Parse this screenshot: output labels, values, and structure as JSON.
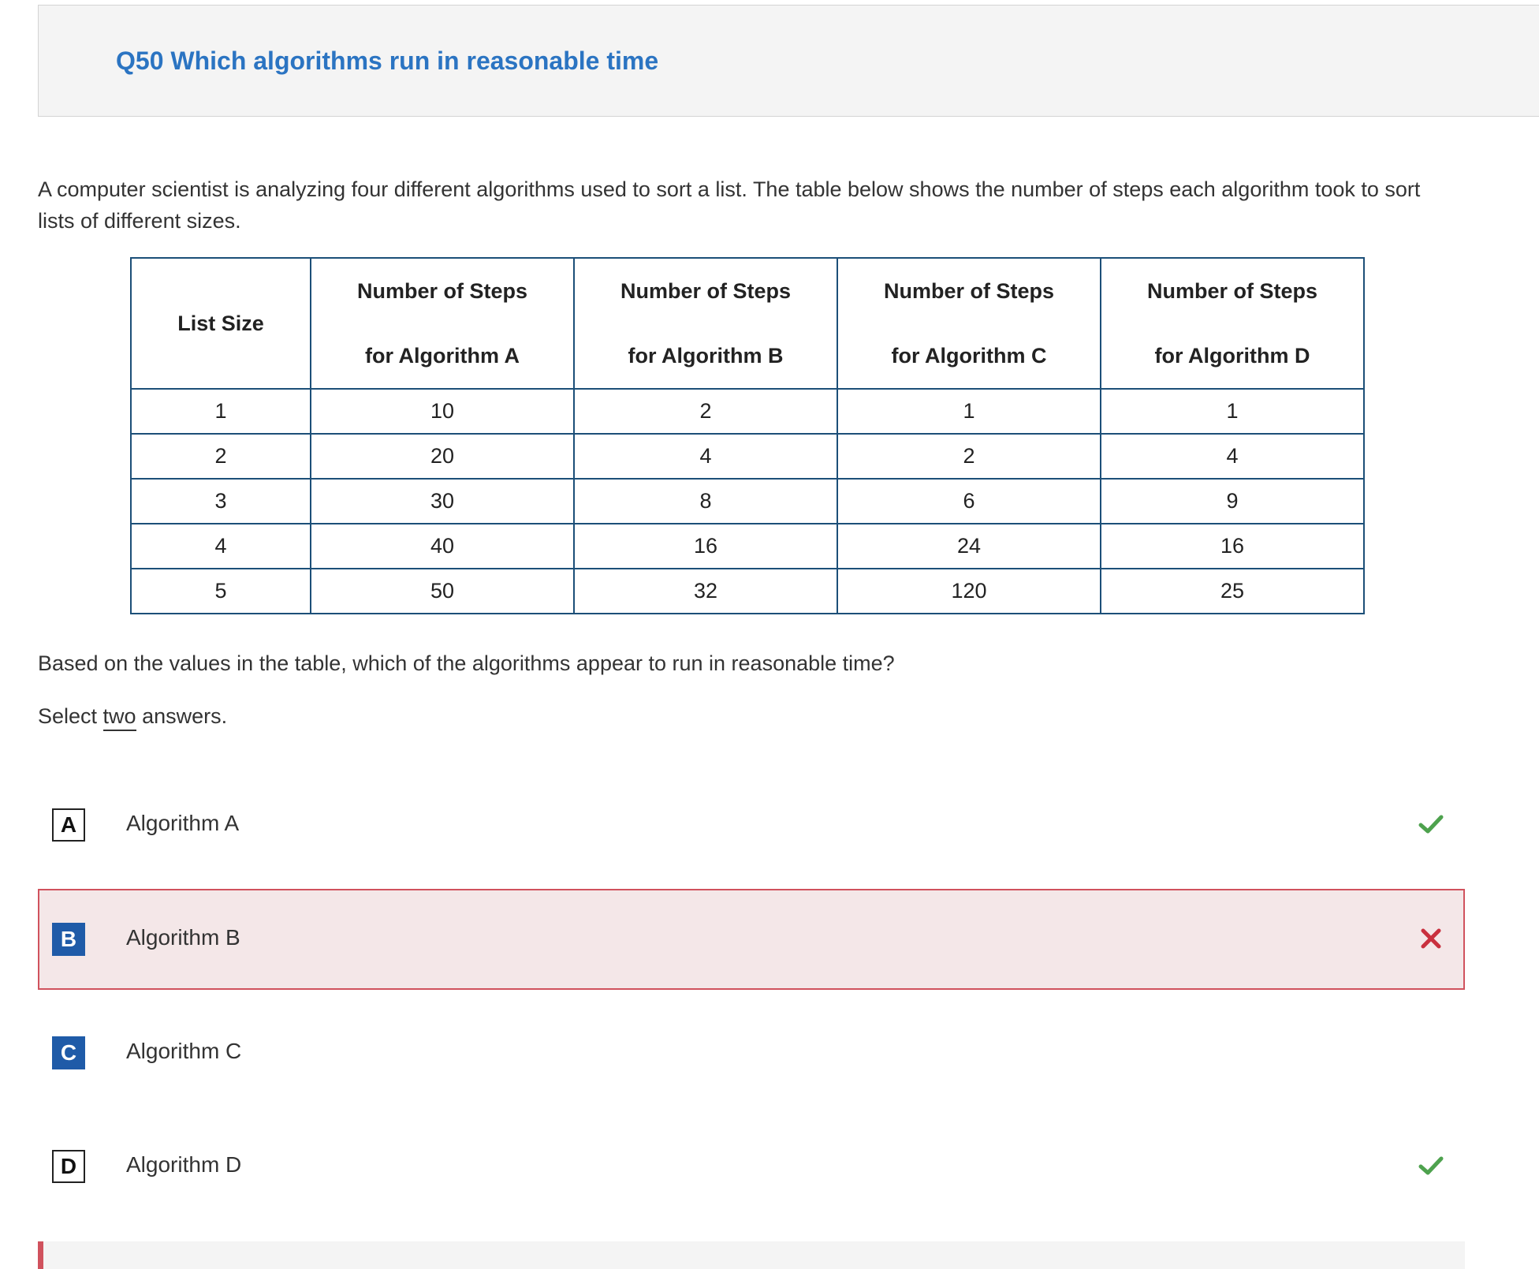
{
  "header": {
    "title": "Q50 Which algorithms run in reasonable time"
  },
  "intro": "A computer scientist is analyzing four different algorithms used to sort a list. The table below shows the number of steps each algorithm took to sort lists of different sizes.",
  "table": {
    "headers": [
      {
        "line1": "List Size",
        "line2": ""
      },
      {
        "line1": "Number of Steps",
        "line2": "for Algorithm A"
      },
      {
        "line1": "Number of Steps",
        "line2": "for Algorithm B"
      },
      {
        "line1": "Number of Steps",
        "line2": "for Algorithm C"
      },
      {
        "line1": "Number of Steps",
        "line2": "for Algorithm D"
      }
    ],
    "rows": [
      [
        "1",
        "10",
        "2",
        "1",
        "1"
      ],
      [
        "2",
        "20",
        "4",
        "2",
        "4"
      ],
      [
        "3",
        "30",
        "8",
        "6",
        "9"
      ],
      [
        "4",
        "40",
        "16",
        "24",
        "16"
      ],
      [
        "5",
        "50",
        "32",
        "120",
        "25"
      ]
    ]
  },
  "question": "Based on the values in the table, which of the algorithms appear to run in reasonable time?",
  "instruction": {
    "prefix": "Select ",
    "emphasis": "two",
    "suffix": " answers."
  },
  "options": [
    {
      "letter": "A",
      "label": "Algorithm A",
      "selected": false,
      "status": "correct"
    },
    {
      "letter": "B",
      "label": "Algorithm B",
      "selected": true,
      "status": "incorrect"
    },
    {
      "letter": "C",
      "label": "Algorithm C",
      "selected": true,
      "status": "none"
    },
    {
      "letter": "D",
      "label": "Algorithm D",
      "selected": false,
      "status": "correct"
    }
  ],
  "colors": {
    "title": "#2b74c2",
    "selected_letter": "#1f5ba8",
    "correct_check": "#4ea24e",
    "incorrect_x": "#c9303e",
    "incorrect_bg": "#f4e7e8",
    "table_border": "#1c4f78"
  }
}
